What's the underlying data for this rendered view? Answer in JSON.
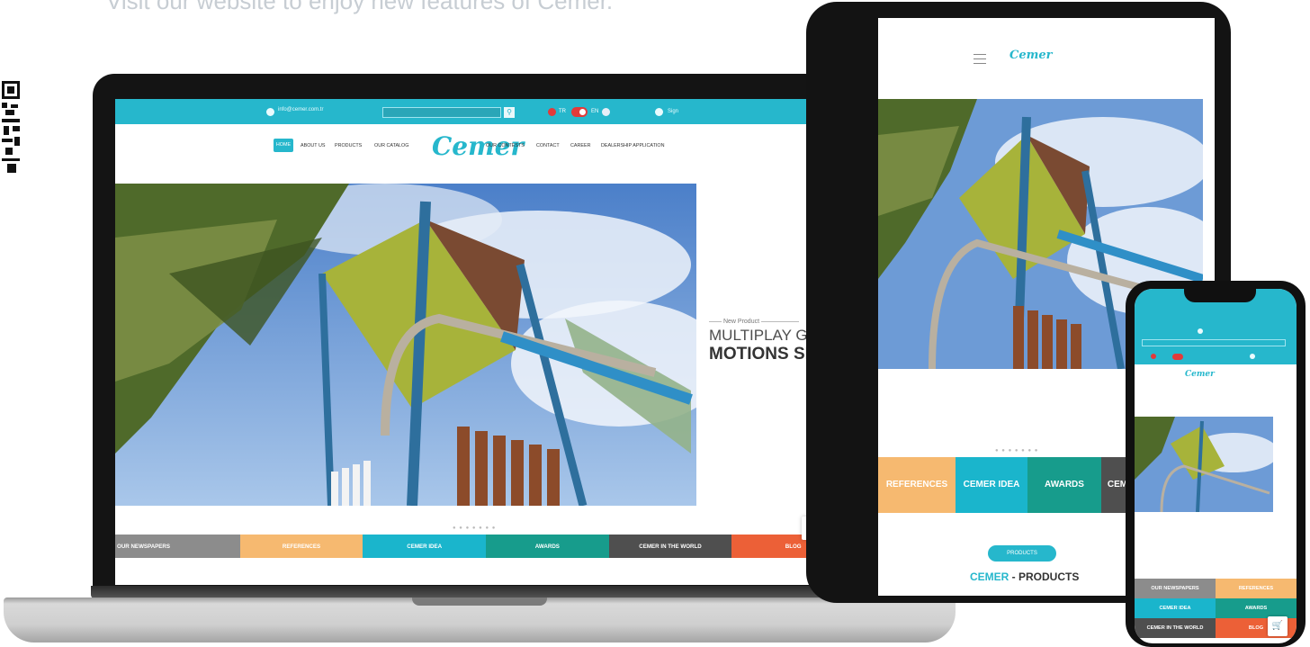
{
  "tagline": "Visit our website to enjoy new features of Cemer.",
  "site": {
    "email": "info@cemer.com.tr",
    "lang_tr": "TR",
    "lang_en": "EN",
    "sign_in": "Sign",
    "logo": "Cemer",
    "nav": [
      "HOME",
      "ABOUT US",
      "PRODUCTS",
      "OUR CATALOG",
      "OUR CONTESTS",
      "CONTACT",
      "CAREER",
      "DEALERSHIP APPLICATION"
    ],
    "hero": {
      "kicker": "New Product",
      "line1": "MULTIPLAY GROUP",
      "line2": "MOTIONS SERIES"
    },
    "cart_count": "0",
    "laptop_tiles": [
      {
        "label": "OUR NEWSPAPERS",
        "color": "#8c8c8c"
      },
      {
        "label": "REFERENCES",
        "color": "#f6b970"
      },
      {
        "label": "CEMER IDEA",
        "color": "#1ab5cc"
      },
      {
        "label": "AWARDS",
        "color": "#179c8c"
      },
      {
        "label": "CEMER IN THE WORLD",
        "color": "#4f4f4f"
      },
      {
        "label": "BLOG",
        "color": "#ec6037"
      }
    ],
    "tablet_tiles": [
      {
        "label": "REFERENCES",
        "color": "#f6b970"
      },
      {
        "label": "CEMER IDEA",
        "color": "#1ab5cc"
      },
      {
        "label": "AWARDS",
        "color": "#179c8c"
      },
      {
        "label": "CEMER IN THE WORLD",
        "color": "#4f4f4f"
      }
    ],
    "phone_tiles": [
      {
        "label": "OUR NEWSPAPERS",
        "color": "#8c8c8c"
      },
      {
        "label": "REFERENCES",
        "color": "#f6b970"
      },
      {
        "label": "CEMER IDEA",
        "color": "#1ab5cc"
      },
      {
        "label": "AWARDS",
        "color": "#179c8c"
      },
      {
        "label": "CEMER IN THE WORLD",
        "color": "#4f4f4f"
      },
      {
        "label": "BLOG",
        "color": "#ec6037"
      }
    ],
    "products_button": "PRODUCTS",
    "products_title_a": "CEMER",
    "products_title_b": " - PRODUCTS",
    "accent": "#26b7cc"
  }
}
